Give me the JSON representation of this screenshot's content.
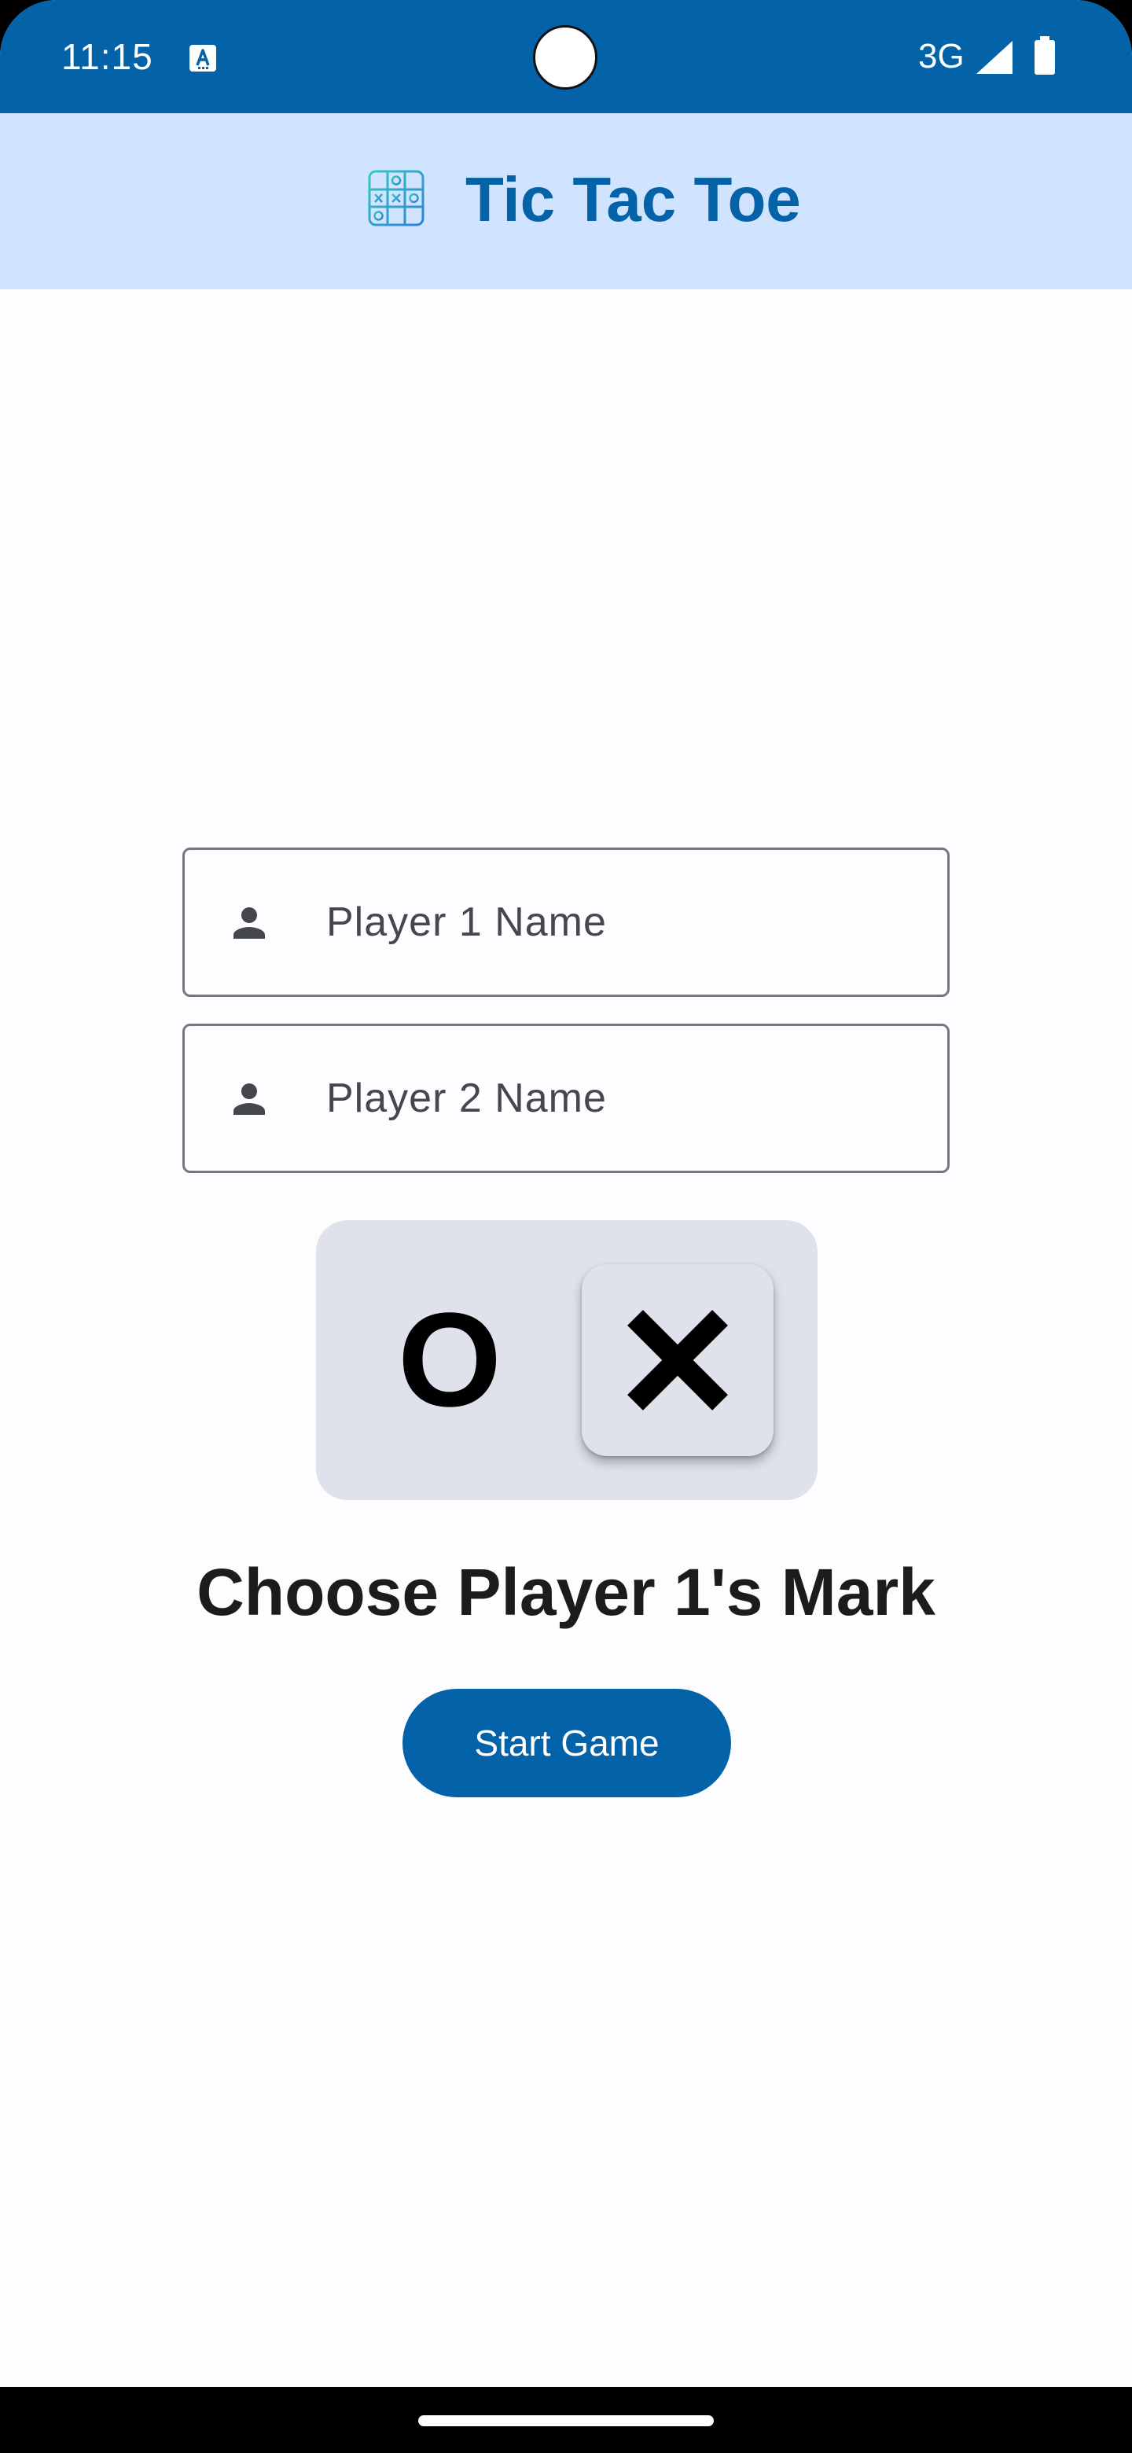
{
  "status_bar": {
    "time": "11:15",
    "network": "3G",
    "icons": [
      "keyboard-a-icon",
      "signal-icon",
      "battery-icon"
    ]
  },
  "app_bar": {
    "title": "Tic Tac Toe",
    "logo_icon": "tic-tac-toe-grid-icon"
  },
  "form": {
    "player1": {
      "placeholder": "Player 1 Name",
      "value": "",
      "icon": "person-icon"
    },
    "player2": {
      "placeholder": "Player 2 Name",
      "value": "",
      "icon": "person-icon"
    },
    "mark_toggle": {
      "options": [
        "O",
        "X"
      ],
      "selected": "X"
    },
    "choose_label": "Choose Player 1's Mark",
    "start_label": "Start Game"
  },
  "colors": {
    "primary": "#0462a8",
    "app_bar_bg": "#d1e4ff",
    "toggle_bg": "#e0e2eb",
    "background": "#fdfcff"
  }
}
